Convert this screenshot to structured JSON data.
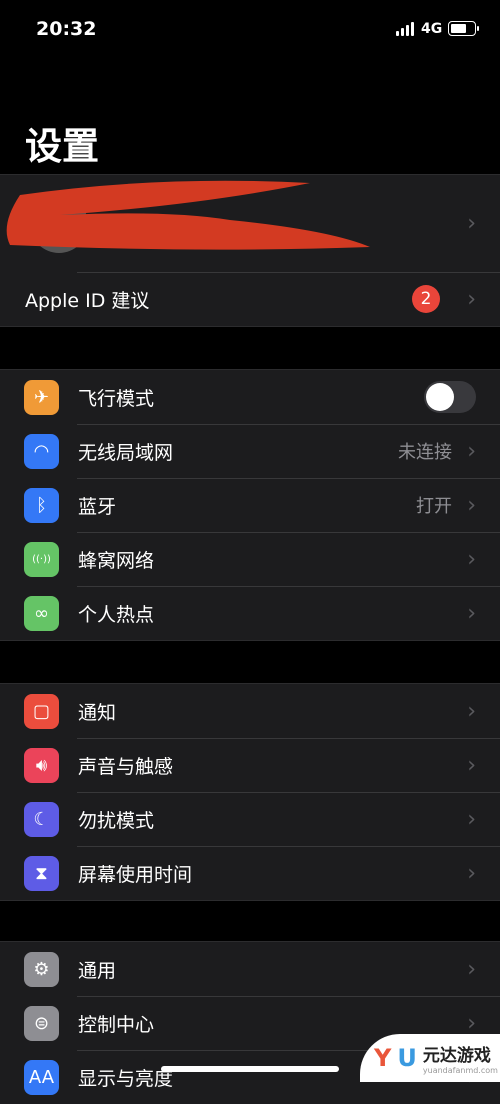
{
  "status": {
    "time": "20:32",
    "network": "4G",
    "battery_level": 0.75
  },
  "title": "设置",
  "profile": {
    "apple_id_suggestions": "Apple ID 建议",
    "badge": "2"
  },
  "group1": [
    {
      "label": "飞行模式",
      "icon": "airplane-icon",
      "color": "#f09a37",
      "toggle": false
    },
    {
      "label": "无线局域网",
      "icon": "wifi-icon",
      "color": "#3478f6",
      "value": "未连接"
    },
    {
      "label": "蓝牙",
      "icon": "bluetooth-icon",
      "color": "#3478f6",
      "value": "打开"
    },
    {
      "label": "蜂窝网络",
      "icon": "cellular-icon",
      "color": "#65c466"
    },
    {
      "label": "个人热点",
      "icon": "hotspot-icon",
      "color": "#65c466"
    }
  ],
  "group2": [
    {
      "label": "通知",
      "icon": "notifications-icon",
      "color": "#eb4d3d"
    },
    {
      "label": "声音与触感",
      "icon": "sound-icon",
      "color": "#eb445a"
    },
    {
      "label": "勿扰模式",
      "icon": "moon-icon",
      "color": "#5e5ce6"
    },
    {
      "label": "屏幕使用时间",
      "icon": "hourglass-icon",
      "color": "#5e5ce6"
    }
  ],
  "group3": [
    {
      "label": "通用",
      "icon": "gear-icon",
      "color": "#8e8e93"
    },
    {
      "label": "控制中心",
      "icon": "switches-icon",
      "color": "#8e8e93"
    },
    {
      "label": "显示与亮度",
      "icon": "text-size-icon",
      "color": "#3478f6"
    }
  ],
  "watermark": {
    "text": "元达游戏",
    "url": "yuandafanmd.com"
  }
}
